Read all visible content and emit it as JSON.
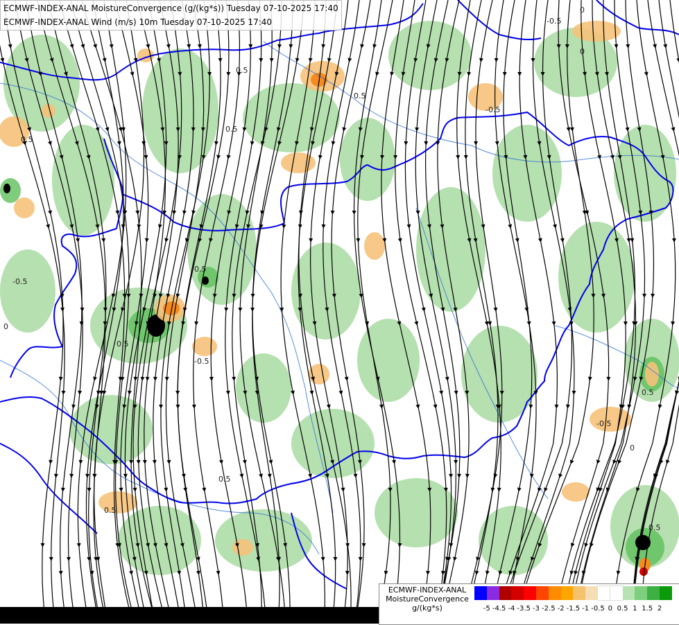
{
  "header": {
    "line1": "ECMWF-INDEX-ANAL MoistureConvergence (g/(kg*s)) Tuesday 07-10-2025 17:40",
    "line2": "ECMWF-INDEX-ANAL Wind (m/s) 10m Tuesday 07-10-2025 17:40"
  },
  "legend": {
    "line1": "ECMWF-INDEX-ANAL",
    "line2": "MoistureConvergence",
    "line3": "g/(kg*s)",
    "colors": [
      "#0000ff",
      "#8a2be2",
      "#b00000",
      "#d40000",
      "#ff0000",
      "#ff4500",
      "#ff8c00",
      "#ffa500",
      "#f5c16c",
      "#f5deb3",
      "#ffffff",
      "#ffffff",
      "#b7e3b3",
      "#7dcf7d",
      "#3cb043",
      "#0a9a0a"
    ],
    "ticks": [
      "-5",
      "-4.5",
      "-4",
      "-3.5",
      "-3",
      "-2.5",
      "-2",
      "-1.5",
      "-1",
      "-0.5",
      "0",
      "0.5",
      "1",
      "1.5",
      "2"
    ]
  },
  "contour_labels": [
    "-0.5",
    "0.5",
    "0",
    "-0.5",
    "0.5",
    "0.5",
    "-0.5",
    "0.5",
    "0",
    "0.5",
    "-0.5",
    "0.5",
    "0",
    "0.5",
    "0.5",
    "-0.5",
    "0",
    "0.5",
    "0.5"
  ],
  "colors": {
    "border": "#0000ee",
    "river": "#2f6fd6",
    "streamline": "#000000",
    "background_bar": "#000000"
  }
}
